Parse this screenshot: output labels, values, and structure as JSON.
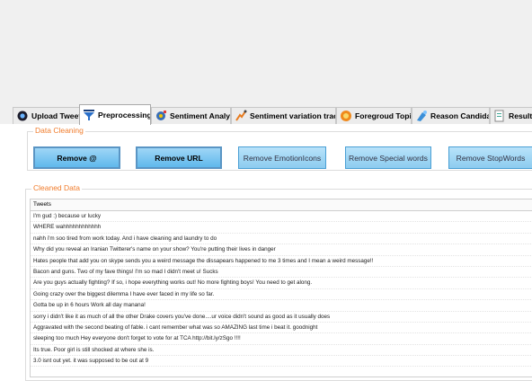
{
  "tabs": [
    {
      "label": "Upload Tweet",
      "icon": "upload-icon",
      "active": false
    },
    {
      "label": "Preprocessing",
      "icon": "preprocessing-icon",
      "active": true
    },
    {
      "label": "Sentiment Analysis",
      "icon": "analysis-icon",
      "active": false
    },
    {
      "label": "Sentiment variation tracking",
      "icon": "tracking-icon",
      "active": false
    },
    {
      "label": "Foregroud Topic",
      "icon": "topic-icon",
      "active": false
    },
    {
      "label": "Reason Candidate",
      "icon": "candidate-icon",
      "active": false
    },
    {
      "label": "Result",
      "icon": "result-icon",
      "active": false
    }
  ],
  "data_cleaning": {
    "title": "Data Cleaning",
    "buttons": [
      {
        "label": "Remove @"
      },
      {
        "label": "Remove URL"
      },
      {
        "label": "Remove EmotionIcons"
      },
      {
        "label": "Remove Special words"
      },
      {
        "label": "Remove StopWords"
      }
    ]
  },
  "cleaned_data": {
    "title": "Cleaned Data",
    "column_header": "Tweets",
    "rows": [
      "I'm gud :) because ur lucky",
      "WHERE wahhhhhhhhhhhh",
      " nahh i'm soo tired from work today. And i have cleaning and laundry to do",
      " Why did you reveal an Iranian Twitterer's name on your show? You're putting their lives in danger",
      "Hates people that add you on skype sends you a weird message the dissapears happened to me 3 times  and I mean a weird message!!",
      " Bacon and guns. Two of my fave things! I'm so mad I didn't meet u! Sucks",
      " Are you guys actually fighting? If so, i hope everything works out! No more fighting boys! You need to get along.",
      "Going crazy over the biggest dilemma I have ever faced in my life so far.",
      "Gotta be up in 6 hours  Work all day manana!",
      " sorry i didn't like it as much of all the other Drake covers you've done....ur voice didn't sound as good as it usually does",
      "Aggravated with the second beating of fable.  i cant remember what was so AMAZING  last time i beat it. goodnight",
      " sleeping too much  Hey everyone don't forget to vote for at TCA http://bit.ly/zSgo !!!!",
      "Its true.  Poor girl is still shocked at where she is.",
      "3.0 isnt out yet. it was supposed to be out at 9"
    ]
  },
  "colors": {
    "accent": "#f07c2c",
    "button_blue": "#5fb8ec",
    "background": "#f0f0f0"
  }
}
